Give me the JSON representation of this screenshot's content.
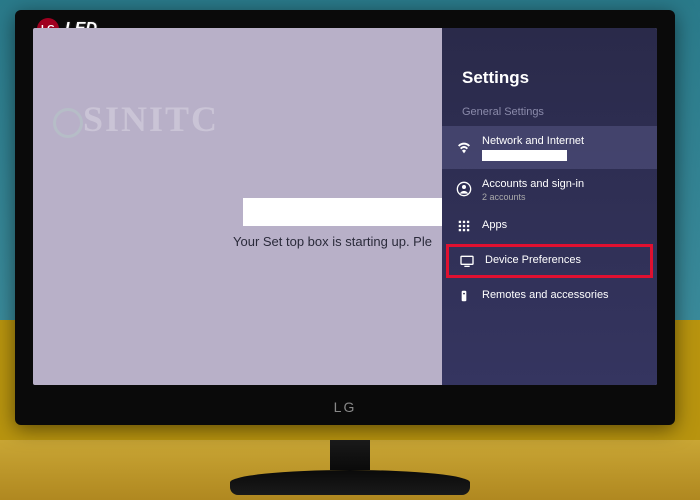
{
  "tv": {
    "brand": "LG",
    "model": "LED"
  },
  "watermark": "SINITC",
  "main": {
    "startup_message": "Your Set top box is starting up. Ple"
  },
  "settings": {
    "title": "Settings",
    "section": "General Settings",
    "items": [
      {
        "label": "Network and Internet",
        "icon": "wifi"
      },
      {
        "label": "Accounts and sign-in",
        "sublabel": "2 accounts",
        "icon": "account"
      },
      {
        "label": "Apps",
        "icon": "apps"
      },
      {
        "label": "Device Preferences",
        "icon": "tv"
      },
      {
        "label": "Remotes and accessories",
        "icon": "remote"
      }
    ]
  }
}
